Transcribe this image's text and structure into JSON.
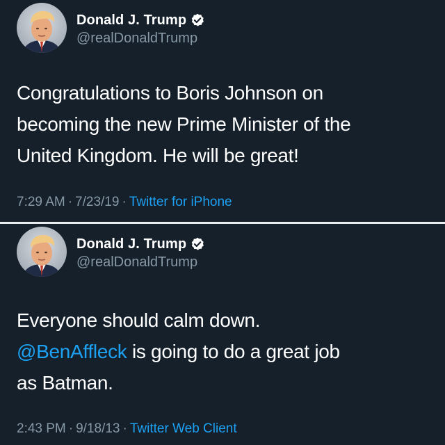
{
  "colors": {
    "background": "#15202b",
    "divider": "#e9ecef",
    "text": "#ffffff",
    "muted": "#8899a6",
    "accent": "#1da1f2"
  },
  "tweets": [
    {
      "author": {
        "name": "Donald J. Trump",
        "handle": "@realDonaldTrump",
        "verified": true,
        "avatar_icon": "profile-photo"
      },
      "text_lines": [
        "Congratulations to Boris Johnson on",
        "becoming the new Prime Minister of the",
        "United Kingdom. He will be great!"
      ],
      "time": "7:29 AM",
      "separator": "·",
      "date": "7/23/19",
      "source": "Twitter for iPhone"
    },
    {
      "author": {
        "name": "Donald J. Trump",
        "handle": "@realDonaldTrump",
        "verified": true,
        "avatar_icon": "profile-photo"
      },
      "text_lines": [
        "Everyone should calm down.",
        "is going to do a great job",
        "as Batman."
      ],
      "mention": "@BenAffleck",
      "time": "2:43 PM",
      "separator": "·",
      "date": "9/18/13",
      "source": "Twitter Web Client"
    }
  ]
}
